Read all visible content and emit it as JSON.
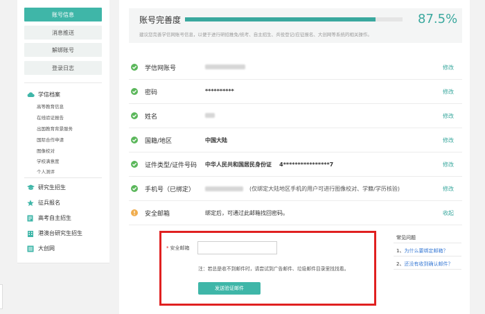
{
  "sidebar": {
    "buttons": [
      {
        "label": "账号信息",
        "active": true
      },
      {
        "label": "消息推送",
        "active": false
      },
      {
        "label": "解绑账号",
        "active": false
      },
      {
        "label": "登录日志",
        "active": false
      }
    ],
    "archive": {
      "label": "学信档案",
      "icon": "cloud-icon",
      "items": [
        "高等教育信息",
        "在线验证报告",
        "出国教育背景服务",
        "国际合作申请",
        "图像校对",
        "学校满意度",
        "个人测评"
      ]
    },
    "groups": [
      {
        "label": "研究生招生",
        "icon": "graduation-cap-icon"
      },
      {
        "label": "征兵报名",
        "icon": "star-icon"
      },
      {
        "label": "高考自主招生",
        "icon": "document-icon"
      },
      {
        "label": "港澳台研究生招生",
        "icon": "building-icon"
      },
      {
        "label": "大创网",
        "icon": "grid-icon"
      }
    ]
  },
  "completeness": {
    "title": "账号完善度",
    "percent_text": "87.5%",
    "progress": 0.875,
    "note": "建议您完善学信网账号信息，以便于进行研招推免/统考、自主招生、兵役登记/应征报名、大创网等系统的相关操作。"
  },
  "rows": [
    {
      "label": "学信网账号",
      "status": "ok",
      "value": "",
      "action": "修改"
    },
    {
      "label": "密码",
      "status": "ok",
      "value": "**********",
      "action": "修改"
    },
    {
      "label": "姓名",
      "status": "ok",
      "value": "",
      "action": "修改"
    },
    {
      "label": "国籍/地区",
      "status": "ok",
      "value": "中国大陆",
      "action": "修改"
    },
    {
      "label": "证件类型/证件号码",
      "status": "ok",
      "value": "中华人民共和国居民身份证    4****************7",
      "action": "修改"
    },
    {
      "label": "手机号（已绑定）",
      "status": "ok",
      "value": "",
      "hint": "(仅绑定大陆地区手机的用户可进行图像校对、学籍/学历核验)",
      "action": "修改"
    },
    {
      "label": "安全邮箱",
      "status": "warn",
      "value": "绑定后，可通过此邮箱找回密码。",
      "action": "收起"
    }
  ],
  "email_form": {
    "required_mark": "*",
    "label": "安全邮箱",
    "value": "",
    "placeholder": "",
    "note": "注：若总是收不到邮件时，请尝试到广告邮件、垃圾邮件目录里找找看。",
    "button": "发送验证邮件"
  },
  "faq": {
    "title": "常见问题",
    "items": [
      {
        "num": "1、",
        "text": "为什么要绑定邮箱？"
      },
      {
        "num": "2、",
        "text": "还没有收到确认邮件？"
      }
    ]
  },
  "colors": {
    "accent": "#3fb6a8",
    "ok": "#5bb75b",
    "warn": "#f0ad4e",
    "highlight": "#e02020"
  }
}
